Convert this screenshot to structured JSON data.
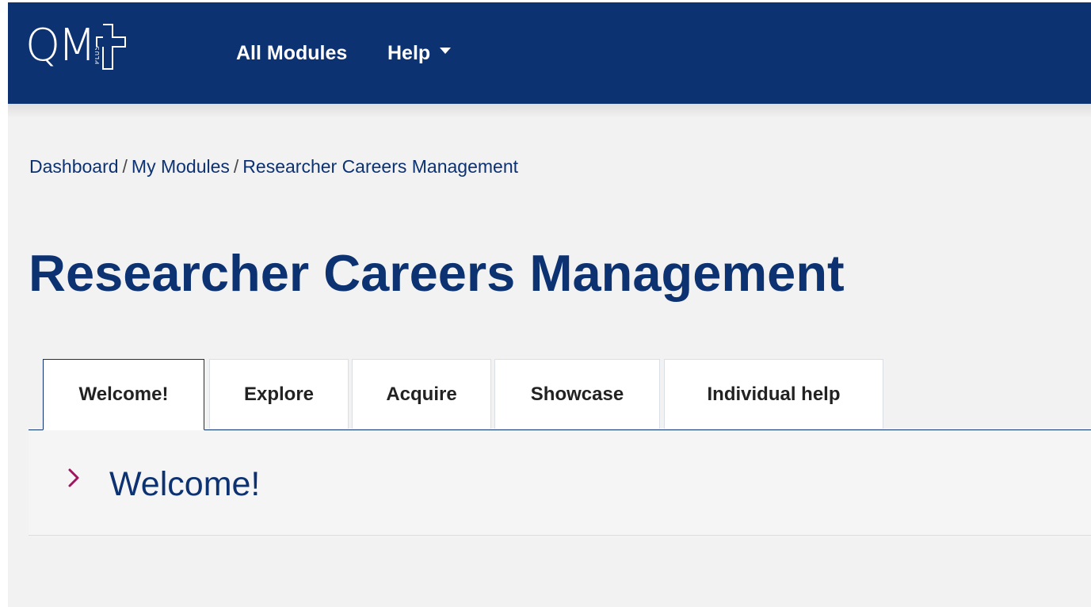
{
  "logo": {
    "text": "QM",
    "plus_text": "PLUS"
  },
  "nav": {
    "all_modules": "All Modules",
    "help": "Help"
  },
  "breadcrumb": {
    "items": [
      "Dashboard",
      "My Modules",
      "Researcher Careers Management"
    ],
    "separator": "/"
  },
  "page_title": "Researcher Careers Management",
  "tabs": [
    {
      "label": "Welcome!",
      "active": true
    },
    {
      "label": "Explore",
      "active": false
    },
    {
      "label": "Acquire",
      "active": false
    },
    {
      "label": "Showcase",
      "active": false
    },
    {
      "label": "Individual help",
      "active": false
    }
  ],
  "section": {
    "title": "Welcome!",
    "collapsed": true
  },
  "colors": {
    "brand_navy": "#0d3272",
    "chevron_accent": "#a0155f",
    "page_bg": "#f2f2f2"
  },
  "icons": {
    "help_dropdown": "caret-down-icon",
    "section_toggle": "chevron-right-icon"
  }
}
